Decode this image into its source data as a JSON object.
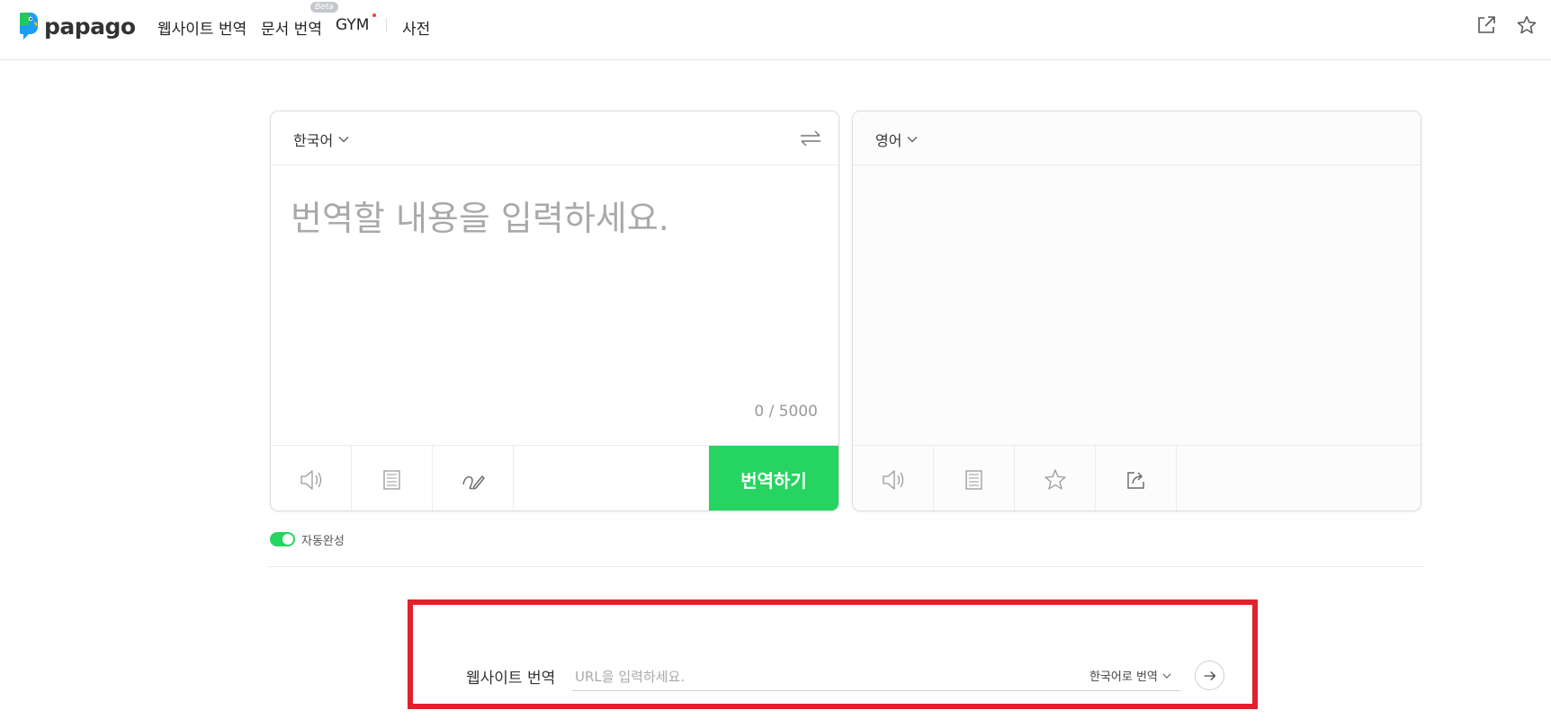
{
  "header": {
    "logo_text": "papago",
    "nav": {
      "website_translation": "웹사이트 번역",
      "document_translation": "문서 번역",
      "beta": "Beta",
      "gym": "GYM",
      "dictionary": "사전"
    },
    "icons": [
      "external-link-icon",
      "star-icon"
    ]
  },
  "source_panel": {
    "language": "한국어",
    "placeholder": "번역할 내용을 입력하세요.",
    "counter": "0 / 5000",
    "translate_button": "번역하기",
    "toolbar_icons": [
      "speaker-icon",
      "copy-icon",
      "handwriting-icon"
    ]
  },
  "target_panel": {
    "language": "영어",
    "toolbar_icons": [
      "speaker-icon",
      "copy-icon",
      "star-icon",
      "share-icon"
    ]
  },
  "autocomplete": {
    "label": "자동완성",
    "enabled": true
  },
  "website_translate": {
    "label": "웹사이트 번역",
    "placeholder": "URL을 입력하세요.",
    "target_language": "한국어로 번역"
  },
  "colors": {
    "accent_green": "#26d462",
    "highlight_red": "#e0222c"
  }
}
